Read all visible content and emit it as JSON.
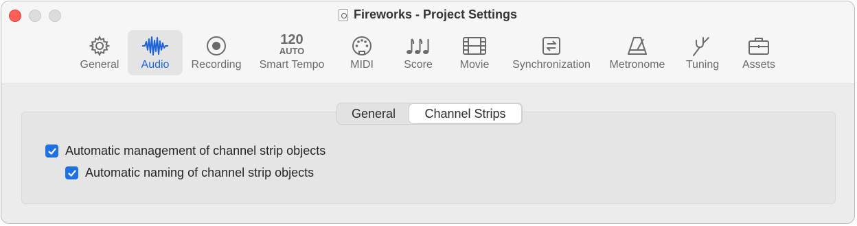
{
  "window": {
    "title": "Fireworks - Project Settings"
  },
  "toolbar": {
    "items": [
      {
        "label": "General",
        "icon": "gear-icon",
        "selected": false
      },
      {
        "label": "Audio",
        "icon": "waveform-icon",
        "selected": true
      },
      {
        "label": "Recording",
        "icon": "record-icon",
        "selected": false
      },
      {
        "label": "Smart Tempo",
        "tempo_value": "120",
        "tempo_mode": "AUTO",
        "selected": false
      },
      {
        "label": "MIDI",
        "icon": "midi-port-icon",
        "selected": false
      },
      {
        "label": "Score",
        "icon": "music-notes-icon",
        "selected": false
      },
      {
        "label": "Movie",
        "icon": "film-icon",
        "selected": false
      },
      {
        "label": "Synchronization",
        "icon": "sync-icon",
        "selected": false
      },
      {
        "label": "Metronome",
        "icon": "metronome-icon",
        "selected": false
      },
      {
        "label": "Tuning",
        "icon": "tuning-fork-icon",
        "selected": false
      },
      {
        "label": "Assets",
        "icon": "briefcase-icon",
        "selected": false
      }
    ]
  },
  "tabs": {
    "general": "General",
    "channel_strips": "Channel Strips",
    "active": "Channel Strips"
  },
  "options": {
    "auto_management": {
      "label": "Automatic management of channel strip objects",
      "checked": true
    },
    "auto_naming": {
      "label": "Automatic naming of channel strip objects",
      "checked": true
    }
  },
  "colors": {
    "accent": "#1f6fe5",
    "close": "#ff5f57"
  }
}
